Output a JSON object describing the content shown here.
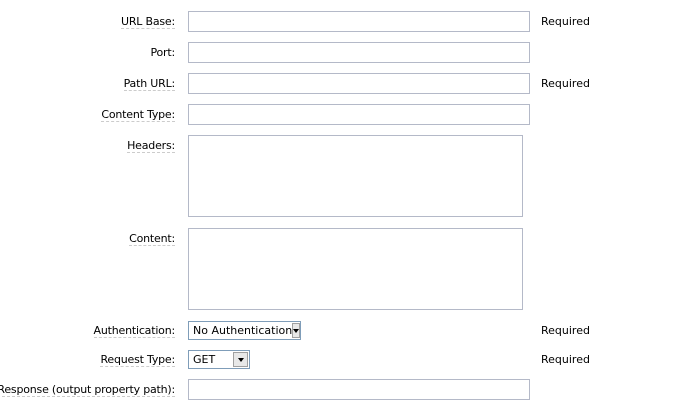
{
  "fields": {
    "url_base": {
      "label": "URL Base:",
      "value": "",
      "required": "Required"
    },
    "port": {
      "label": "Port:",
      "value": ""
    },
    "path_url": {
      "label": "Path URL:",
      "value": "",
      "required": "Required"
    },
    "content_type": {
      "label": "Content Type:",
      "value": ""
    },
    "headers": {
      "label": "Headers:",
      "value": ""
    },
    "content": {
      "label": "Content:",
      "value": ""
    },
    "authentication": {
      "label": "Authentication:",
      "selected": "No Authentication",
      "required": "Required"
    },
    "request_type": {
      "label": "Request Type:",
      "selected": "GET",
      "required": "Required"
    },
    "response": {
      "label": "Response (output property path):",
      "value": ""
    }
  }
}
